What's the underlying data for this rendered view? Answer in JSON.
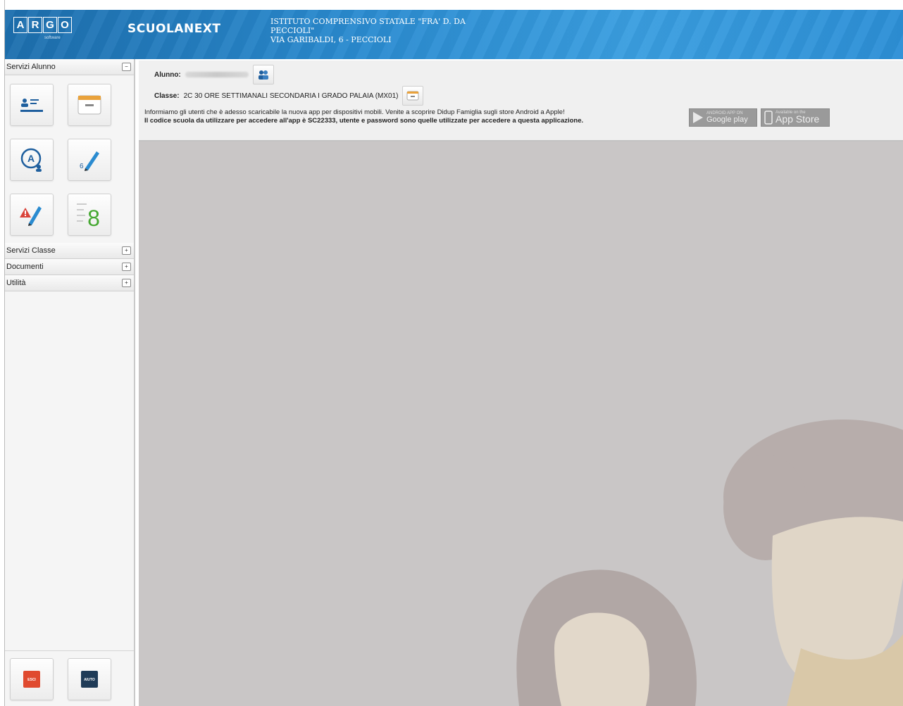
{
  "header": {
    "logo_letters": [
      "A",
      "R",
      "G",
      "O"
    ],
    "logo_sub": "software",
    "brand": "SCUOLANEXT",
    "school_line1": "ISTITUTO COMPRENSIVO STATALE \"FRA' D. DA",
    "school_line2": "PECCIOLI\"",
    "school_line3": "VIA GARIBALDI, 6 - PECCIOLI"
  },
  "sidebar": {
    "sections": [
      {
        "label": "Servizi Alunno",
        "toggle": "−"
      },
      {
        "label": "Servizi Classe",
        "toggle": "+"
      },
      {
        "label": "Documenti",
        "toggle": "+"
      },
      {
        "label": "Utilità",
        "toggle": "+"
      }
    ],
    "tiles": [
      {
        "name": "anagrafe-icon"
      },
      {
        "name": "tasse-icon"
      },
      {
        "name": "assenze-icon"
      },
      {
        "name": "voti-giornalieri-icon"
      },
      {
        "name": "note-disciplinari-icon"
      },
      {
        "name": "voti-scrutinio-icon",
        "text": "8"
      }
    ],
    "bottom": {
      "exit_label": "ESCI",
      "help_label": "AIUTO"
    }
  },
  "info": {
    "alunno_label": "Alunno:",
    "classe_label": "Classe:",
    "classe_value": "2C 30 ORE SETTIMANALI SECONDARIA I GRADO PALAIA (MX01)",
    "notice_line1": "Informiamo gli utenti che è adesso scaricabile la nuova app per dispositivi mobili. Venite a scoprire Didup Famiglia sugli store Android a Apple!",
    "notice_line2": "Il codice scuola da utilizzare per accedere all'app è SC22333, utente e password sono quelle utilizzate per accedere a questa applicazione.",
    "google_small": "ANDROID APP ON",
    "google_label": "Google play",
    "apple_small": "Available on the",
    "apple_label": "App Store"
  },
  "colors": {
    "header": "#2a8bd0",
    "main_bg": "#c9c6c6",
    "exit": "#e04a2f",
    "help": "#1f3b57"
  }
}
